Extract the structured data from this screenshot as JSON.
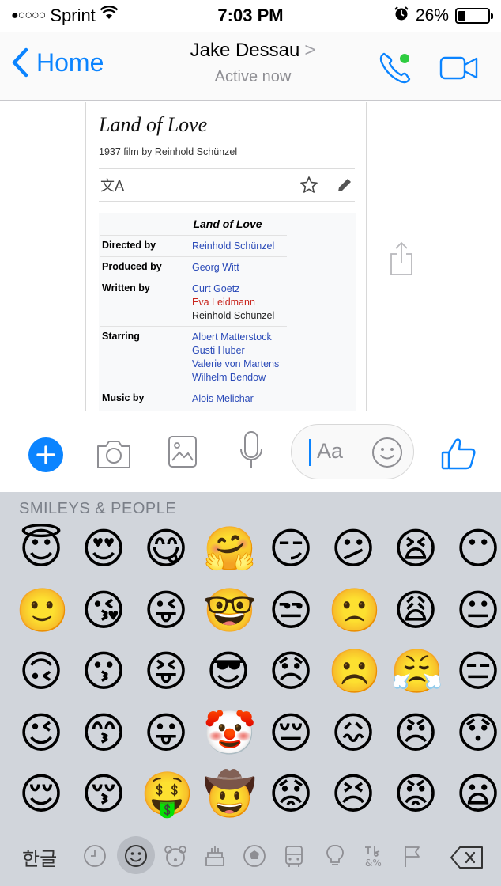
{
  "status_bar": {
    "signal": "●○○○○",
    "carrier": "Sprint",
    "time": "7:03 PM",
    "battery": "26%",
    "battery_level": 0.26
  },
  "nav": {
    "back_label": "Home",
    "contact_name": "Jake Dessau",
    "contact_chevron": ">",
    "status": "Active now",
    "accent_color": "#0b84ff",
    "online_dot_color": "#2ecc40"
  },
  "article": {
    "title": "Land of Love",
    "subtitle": "1937 film by Reinhold Schünzel",
    "translate_glyph": "文A",
    "infobox_title": "Land of Love",
    "rows": [
      {
        "key": "Directed by",
        "values": [
          {
            "text": "Reinhold Schünzel",
            "style": "link"
          }
        ]
      },
      {
        "key": "Produced by",
        "values": [
          {
            "text": "Georg Witt",
            "style": "link"
          }
        ]
      },
      {
        "key": "Written by",
        "values": [
          {
            "text": "Curt Goetz",
            "style": "link"
          },
          {
            "text": "Eva Leidmann",
            "style": "redlink"
          },
          {
            "text": "Reinhold Schünzel",
            "style": "plain"
          }
        ]
      },
      {
        "key": "Starring",
        "values": [
          {
            "text": "Albert Matterstock",
            "style": "link"
          },
          {
            "text": "Gusti Huber",
            "style": "link"
          },
          {
            "text": "Valerie von Martens",
            "style": "link"
          },
          {
            "text": "Wilhelm Bendow",
            "style": "link"
          }
        ]
      },
      {
        "key": "Music by",
        "values": [
          {
            "text": "Alois Melichar",
            "style": "link"
          }
        ]
      }
    ]
  },
  "composer": {
    "placeholder": "Aa"
  },
  "keyboard": {
    "section_header": "SMILEYS & PEOPLE",
    "language_key": "한글",
    "emoji_rows": [
      [
        "😇",
        "😍",
        "😋",
        "🤗",
        "😏",
        "😕",
        "😫",
        "😶"
      ],
      [
        "🙂",
        "😘",
        "😜",
        "🤓",
        "😒",
        "🙁",
        "😩",
        "😐"
      ],
      [
        "🙃",
        "😗",
        "😝",
        "😎",
        "😞",
        "☹️",
        "😤",
        "😑"
      ],
      [
        "😉",
        "😙",
        "😛",
        "🤡",
        "😔",
        "😖",
        "😠",
        "😯"
      ],
      [
        "😌",
        "😚",
        "🤑",
        "🤠",
        "😟",
        "😣",
        "😡",
        "😦"
      ]
    ],
    "categories": [
      "recent-icon",
      "smileys-icon",
      "animals-icon",
      "food-icon",
      "activity-icon",
      "travel-icon",
      "objects-icon",
      "symbols-icon",
      "flags-icon"
    ],
    "active_category": "smileys-icon"
  }
}
